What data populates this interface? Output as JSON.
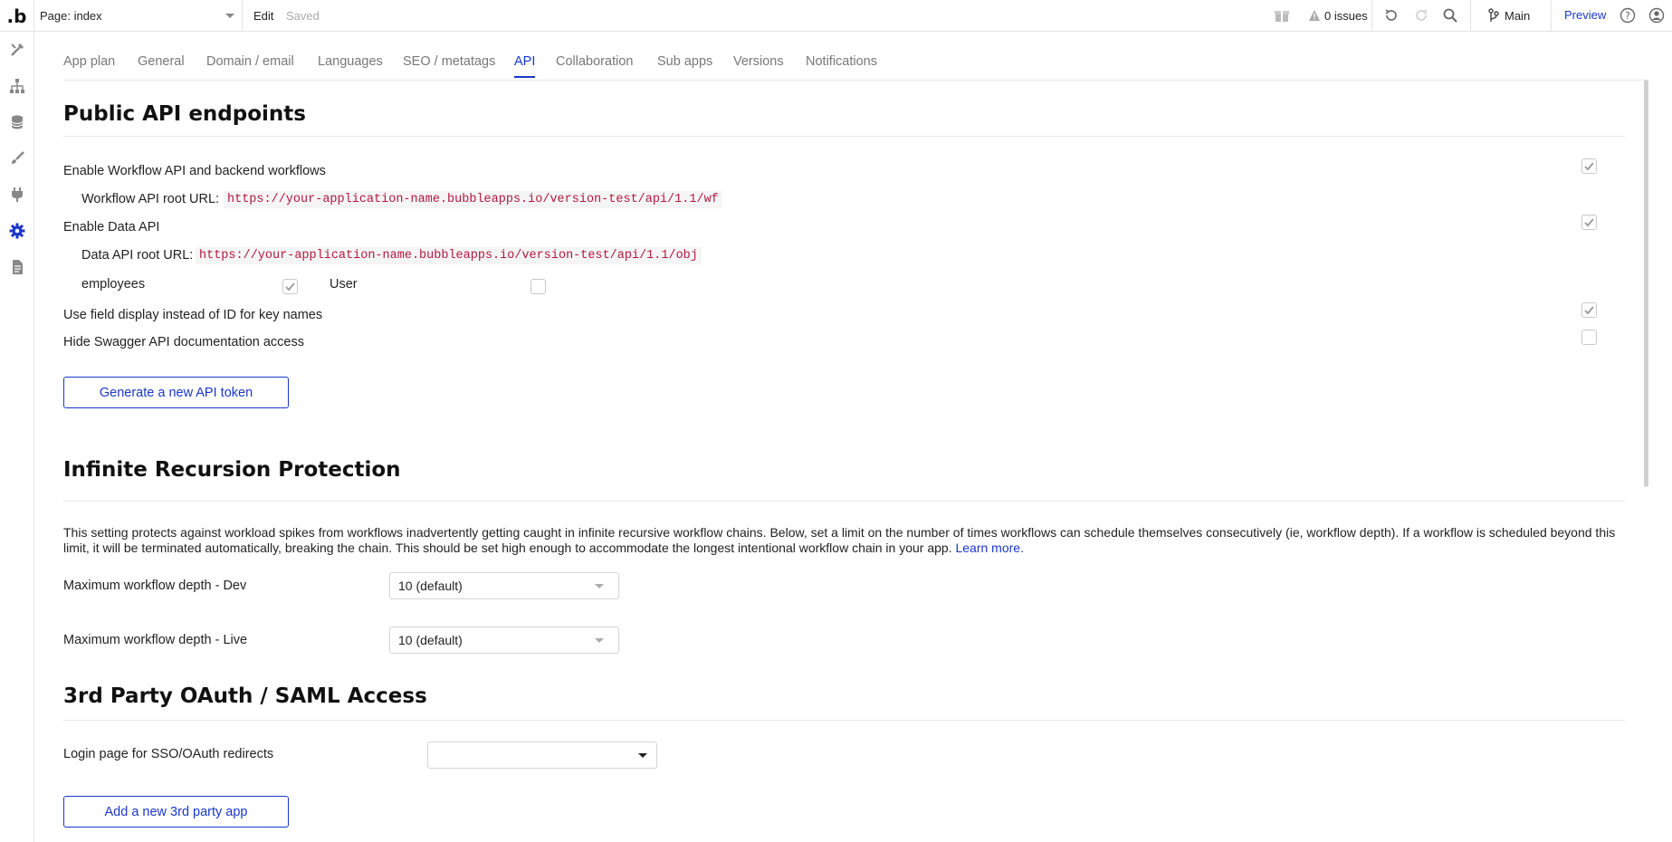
{
  "topbar": {
    "logo": ".b",
    "page_select": "Page: index",
    "edit": "Edit",
    "saved": "Saved",
    "issues": "0 issues",
    "branch": "Main",
    "preview": "Preview"
  },
  "tabs": [
    "App plan",
    "General",
    "Domain / email",
    "Languages",
    "SEO / metatags",
    "API",
    "Collaboration",
    "Sub apps",
    "Versions",
    "Notifications"
  ],
  "active_tab": "API",
  "public_api": {
    "title": "Public API endpoints",
    "enable_workflow_label": "Enable Workflow API and backend workflows",
    "enable_workflow_checked": true,
    "workflow_root_label": "Workflow API root URL:",
    "workflow_root_url": "https://your-application-name.bubbleapps.io/version-test/api/1.1/wf",
    "enable_data_label": "Enable Data API",
    "enable_data_checked": true,
    "data_root_label": "Data API root URL:",
    "data_root_url": "https://your-application-name.bubbleapps.io/version-test/api/1.1/obj",
    "types": [
      {
        "name": "employees",
        "checked": true
      },
      {
        "name": "User",
        "checked": false
      }
    ],
    "field_display_label": "Use field display instead of ID for key names",
    "field_display_checked": true,
    "hide_swagger_label": "Hide Swagger API documentation access",
    "hide_swagger_checked": false,
    "generate_token_button": "Generate a new API token"
  },
  "recursion": {
    "title": "Infinite Recursion Protection",
    "description": "This setting protects against workload spikes from workflows inadvertently getting caught in infinite recursive workflow chains. Below, set a limit on the number of times workflows can schedule themselves consecutively (ie, workflow depth). If a workflow is scheduled beyond this limit, it will be terminated automatically, breaking the chain. This should be set high enough to accommodate the longest intentional workflow chain in your app.",
    "learn_more": "Learn more.",
    "dev_label": "Maximum workflow depth - Dev",
    "dev_value": "10 (default)",
    "live_label": "Maximum workflow depth - Live",
    "live_value": "10 (default)"
  },
  "oauth": {
    "title": "3rd Party OAuth / SAML Access",
    "login_page_label": "Login page for SSO/OAuth redirects",
    "login_page_value": "",
    "add_app_button": "Add a new 3rd party app"
  },
  "colors": {
    "accent": "#1a37c8",
    "url_text": "#b1193f"
  }
}
